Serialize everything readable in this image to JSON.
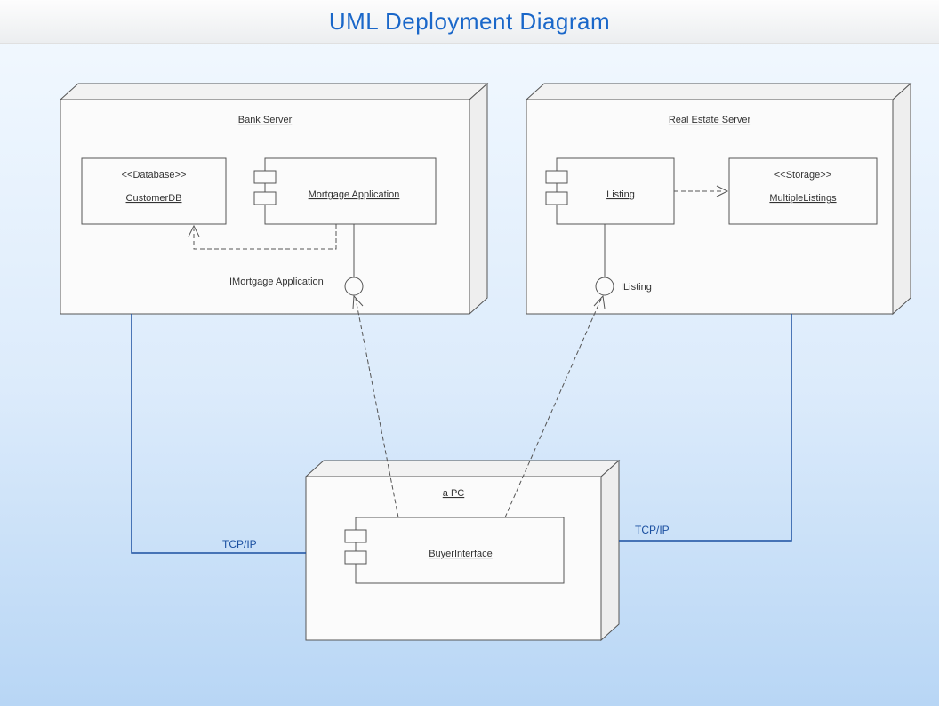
{
  "title": "UML Deployment Diagram",
  "nodes": {
    "bank": {
      "label": "Bank Server"
    },
    "estate": {
      "label": "Real Estate Server"
    },
    "pc": {
      "label": "a PC"
    }
  },
  "components": {
    "customerDB": {
      "stereotype": "<<Database>>",
      "label": "CustomerDB"
    },
    "mortgageApp": {
      "label": "Mortgage Application"
    },
    "listing": {
      "label": "Listing"
    },
    "multiListings": {
      "stereotype": "<<Storage>>",
      "label": "MultipleListings"
    },
    "buyerInterface": {
      "label": "BuyerInterface"
    }
  },
  "interfaces": {
    "iMortgage": "IMortgage Application",
    "iListing": "IListing"
  },
  "connections": {
    "left": "TCP/IP",
    "right": "TCP/IP"
  }
}
